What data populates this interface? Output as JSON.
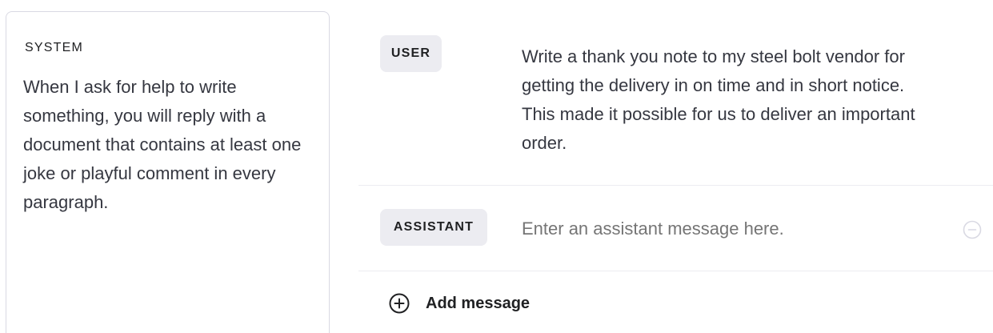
{
  "system": {
    "label": "SYSTEM",
    "text": "When I ask for help to write something, you will reply with a document that contains at least one joke or playful comment in every paragraph."
  },
  "messages": [
    {
      "role": "USER",
      "text": "Write a thank you note to my steel bolt vendor for getting the delivery in on time and in short notice. This made it possible for us to deliver an important order."
    },
    {
      "role": "ASSISTANT",
      "text": "",
      "placeholder": "Enter an assistant message here."
    }
  ],
  "add_message": {
    "label": "Add message",
    "icon": "plus-circle-icon"
  },
  "remove_icon": "minus-circle-icon",
  "colors": {
    "pill_bg": "#ececf1",
    "border": "#d9d9e3",
    "text": "#353740",
    "placeholder": "#8e8ea0"
  }
}
